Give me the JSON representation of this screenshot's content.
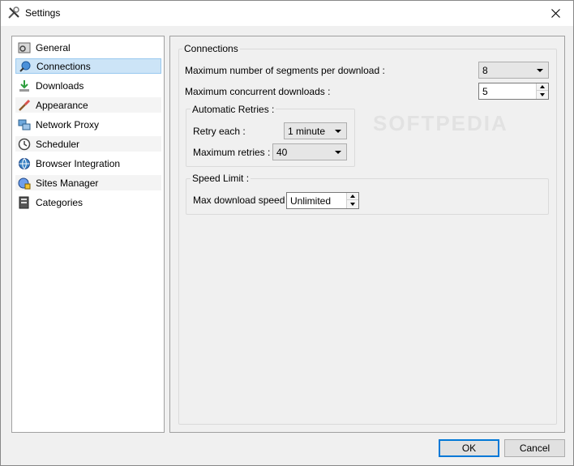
{
  "window": {
    "title": "Settings"
  },
  "sidebar": {
    "items": [
      {
        "label": "General",
        "icon": "general-icon"
      },
      {
        "label": "Connections",
        "icon": "connections-icon",
        "selected": true
      },
      {
        "label": "Downloads",
        "icon": "downloads-icon"
      },
      {
        "label": "Appearance",
        "icon": "appearance-icon"
      },
      {
        "label": "Network Proxy",
        "icon": "network-proxy-icon"
      },
      {
        "label": "Scheduler",
        "icon": "scheduler-icon"
      },
      {
        "label": "Browser Integration",
        "icon": "browser-integration-icon"
      },
      {
        "label": "Sites Manager",
        "icon": "sites-manager-icon"
      },
      {
        "label": "Categories",
        "icon": "categories-icon"
      }
    ]
  },
  "connections": {
    "group_title": "Connections",
    "max_segments_label": "Maximum number of segments per download :",
    "max_segments_value": "8",
    "max_concurrent_label": "Maximum concurrent downloads :",
    "max_concurrent_value": "5",
    "retries": {
      "group_title": "Automatic Retries :",
      "retry_each_label": "Retry each :",
      "retry_each_value": "1 minute",
      "max_retries_label": "Maximum retries :",
      "max_retries_value": "40"
    },
    "speed": {
      "group_title": "Speed Limit :",
      "max_speed_label": "Max download speed :",
      "max_speed_value": "Unlimited"
    }
  },
  "footer": {
    "ok_label": "OK",
    "cancel_label": "Cancel"
  },
  "watermark": "SOFTPEDIA",
  "colors": {
    "selection": "#cce4f7",
    "accent": "#0078d7"
  }
}
